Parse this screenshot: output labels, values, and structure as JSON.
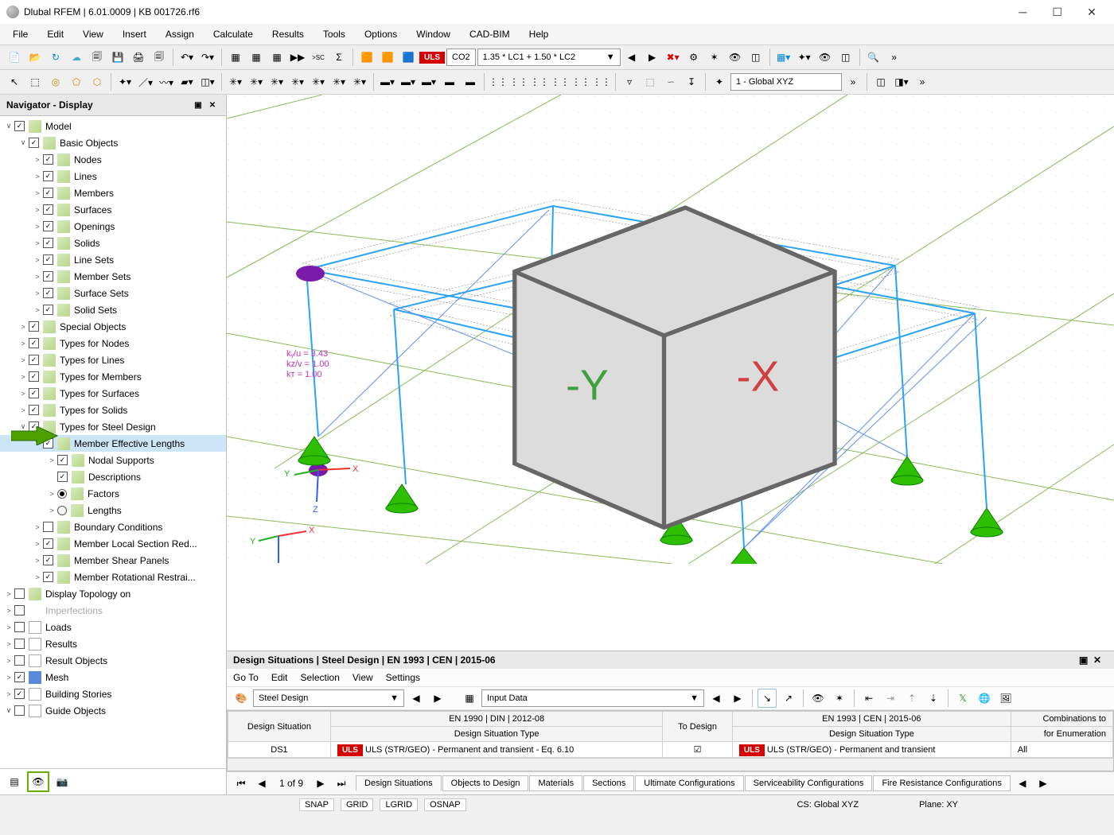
{
  "window": {
    "title": "Dlubal RFEM | 6.01.0009 | KB 001726.rf6"
  },
  "menubar": [
    "File",
    "Edit",
    "View",
    "Insert",
    "Assign",
    "Calculate",
    "Results",
    "Tools",
    "Options",
    "Window",
    "CAD-BIM",
    "Help"
  ],
  "ribbon1": {
    "uls": "ULS",
    "case": "CO2",
    "combo": "1.35 * LC1 + 1.50 * LC2"
  },
  "ribbon2": {
    "cs": "1 - Global XYZ"
  },
  "navigator": {
    "title": "Navigator - Display",
    "tree": [
      {
        "d": 0,
        "a": "open",
        "c": true,
        "i": "pale",
        "t": "Model"
      },
      {
        "d": 1,
        "a": "open",
        "c": true,
        "i": "pale",
        "t": "Basic Objects"
      },
      {
        "d": 2,
        "a": "closed",
        "c": true,
        "i": "pale",
        "t": "Nodes"
      },
      {
        "d": 2,
        "a": "closed",
        "c": true,
        "i": "pale",
        "t": "Lines"
      },
      {
        "d": 2,
        "a": "closed",
        "c": true,
        "i": "pale",
        "t": "Members"
      },
      {
        "d": 2,
        "a": "closed",
        "c": true,
        "i": "pale",
        "t": "Surfaces"
      },
      {
        "d": 2,
        "a": "closed",
        "c": true,
        "i": "pale",
        "t": "Openings"
      },
      {
        "d": 2,
        "a": "closed",
        "c": true,
        "i": "pale",
        "t": "Solids"
      },
      {
        "d": 2,
        "a": "closed",
        "c": true,
        "i": "pale",
        "t": "Line Sets"
      },
      {
        "d": 2,
        "a": "closed",
        "c": true,
        "i": "pale",
        "t": "Member Sets"
      },
      {
        "d": 2,
        "a": "closed",
        "c": true,
        "i": "pale",
        "t": "Surface Sets"
      },
      {
        "d": 2,
        "a": "closed",
        "c": true,
        "i": "pale",
        "t": "Solid Sets"
      },
      {
        "d": 1,
        "a": "closed",
        "c": true,
        "i": "pale",
        "t": "Special Objects"
      },
      {
        "d": 1,
        "a": "closed",
        "c": true,
        "i": "pale",
        "t": "Types for Nodes"
      },
      {
        "d": 1,
        "a": "closed",
        "c": true,
        "i": "pale",
        "t": "Types for Lines"
      },
      {
        "d": 1,
        "a": "closed",
        "c": true,
        "i": "pale",
        "t": "Types for Members"
      },
      {
        "d": 1,
        "a": "closed",
        "c": true,
        "i": "pale",
        "t": "Types for Surfaces"
      },
      {
        "d": 1,
        "a": "closed",
        "c": true,
        "i": "pale",
        "t": "Types for Solids"
      },
      {
        "d": 1,
        "a": "open",
        "c": true,
        "i": "pale",
        "t": "Types for Steel Design"
      },
      {
        "d": 2,
        "a": "open",
        "c": true,
        "i": "pale",
        "t": "Member Effective Lengths",
        "sel": true,
        "arrowCallout": true
      },
      {
        "d": 3,
        "a": "closed",
        "c": true,
        "i": "pale",
        "t": "Nodal Supports"
      },
      {
        "d": 3,
        "a": "none",
        "c": true,
        "i": "pale",
        "t": "Descriptions"
      },
      {
        "d": 3,
        "a": "closed",
        "r": true,
        "i": "pale",
        "t": "Factors"
      },
      {
        "d": 3,
        "a": "closed",
        "r": false,
        "i": "pale",
        "t": "Lengths"
      },
      {
        "d": 2,
        "a": "closed",
        "c": false,
        "i": "pale",
        "t": "Boundary Conditions"
      },
      {
        "d": 2,
        "a": "closed",
        "c": true,
        "i": "pale",
        "t": "Member Local Section Red..."
      },
      {
        "d": 2,
        "a": "closed",
        "c": true,
        "i": "pale",
        "t": "Member Shear Panels"
      },
      {
        "d": 2,
        "a": "closed",
        "c": true,
        "i": "pale",
        "t": "Member Rotational Restrai..."
      },
      {
        "d": 0,
        "a": "closed",
        "c": false,
        "i": "pale",
        "t": "Display Topology on"
      },
      {
        "d": 0,
        "a": "closed",
        "c": false,
        "i": "grey",
        "t": "Imperfections",
        "dim": true
      },
      {
        "d": 0,
        "a": "closed",
        "c": false,
        "i": "edit",
        "t": "Loads"
      },
      {
        "d": 0,
        "a": "closed",
        "c": false,
        "i": "edit",
        "t": "Results"
      },
      {
        "d": 0,
        "a": "closed",
        "c": false,
        "i": "edit",
        "t": "Result Objects"
      },
      {
        "d": 0,
        "a": "closed",
        "c": true,
        "i": "blue",
        "t": "Mesh"
      },
      {
        "d": 0,
        "a": "closed",
        "c": true,
        "i": "edit",
        "t": "Building Stories"
      },
      {
        "d": 0,
        "a": "open",
        "c": false,
        "i": "edit",
        "t": "Guide Objects"
      }
    ]
  },
  "viewport": {
    "annotations": [
      "kᵧ/u = 3.43",
      "kᴢ/v = 1.00",
      "kᴛ  = 1.00"
    ]
  },
  "bottom_panel": {
    "title": "Design Situations | Steel Design | EN 1993 | CEN | 2015-06",
    "menu": [
      "Go To",
      "Edit",
      "Selection",
      "View",
      "Settings"
    ],
    "left_combo": "Steel Design",
    "right_combo": "Input Data",
    "table": {
      "h1": {
        "c1": "Design Situation",
        "c2": "EN 1990 | DIN | 2012-08",
        "c3": "To Design",
        "c4": "EN 1993 | CEN | 2015-06",
        "c5": "Combinations to"
      },
      "h2": {
        "c2": "Design Situation Type",
        "c4": "Design Situation Type",
        "c5": "for Enumeration"
      },
      "row": {
        "ds": "DS1",
        "uls1": "ULS",
        "t1": "ULS (STR/GEO) - Permanent and transient - Eq. 6.10",
        "to": "☑",
        "uls2": "ULS",
        "t2": "ULS (STR/GEO) - Permanent and transient",
        "all": "All"
      }
    },
    "pager": "1 of 9",
    "tabs": [
      "Design Situations",
      "Objects to Design",
      "Materials",
      "Sections",
      "Ultimate Configurations",
      "Serviceability Configurations",
      "Fire Resistance Configurations"
    ]
  },
  "statusbar": {
    "snap": "SNAP",
    "grid": "GRID",
    "lgrid": "LGRID",
    "osnap": "OSNAP",
    "cs": "CS: Global XYZ",
    "plane": "Plane: XY"
  }
}
